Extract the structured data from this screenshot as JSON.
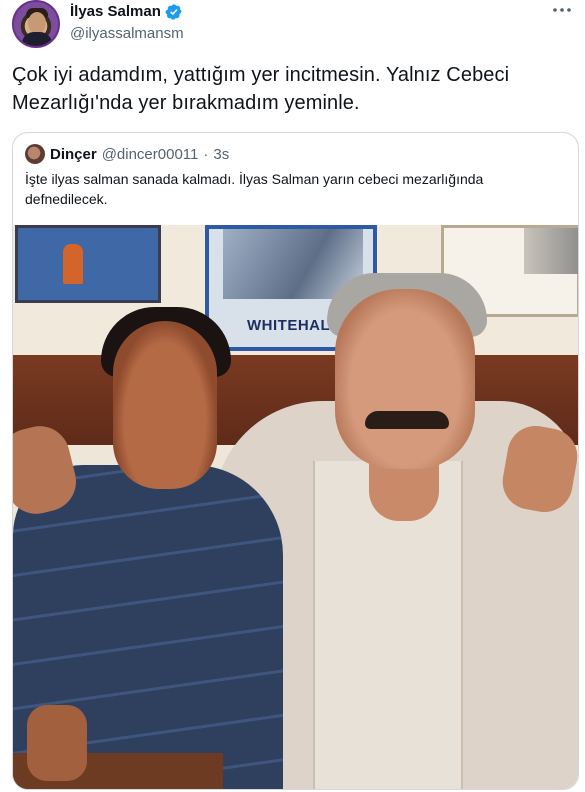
{
  "author": {
    "display_name": "İlyas Salman",
    "handle": "@ilyassalmansm",
    "verified": true
  },
  "tweet": {
    "text": "Çok iyi adamdım, yattığım yer incitmesin. Yalnız Cebeci Mezarlığı'nda yer bırakmadım yeminle."
  },
  "quoted_tweet": {
    "display_name": "Dinçer",
    "handle": "@dincer00011",
    "separator": "·",
    "time": "3s",
    "text": "İşte ilyas salman sanada kalmadı. İlyas Salman yarın cebeci mezarlığında defnedilecek.",
    "photo": {
      "poster_brand": "WHITEHALL"
    }
  },
  "icons": {
    "more": "more-horizontal-icon",
    "verified": "verified-badge-icon"
  },
  "colors": {
    "text_primary": "#0f1419",
    "text_secondary": "#536471",
    "verified_blue": "#1d9bf0",
    "border": "#cfd9de"
  }
}
